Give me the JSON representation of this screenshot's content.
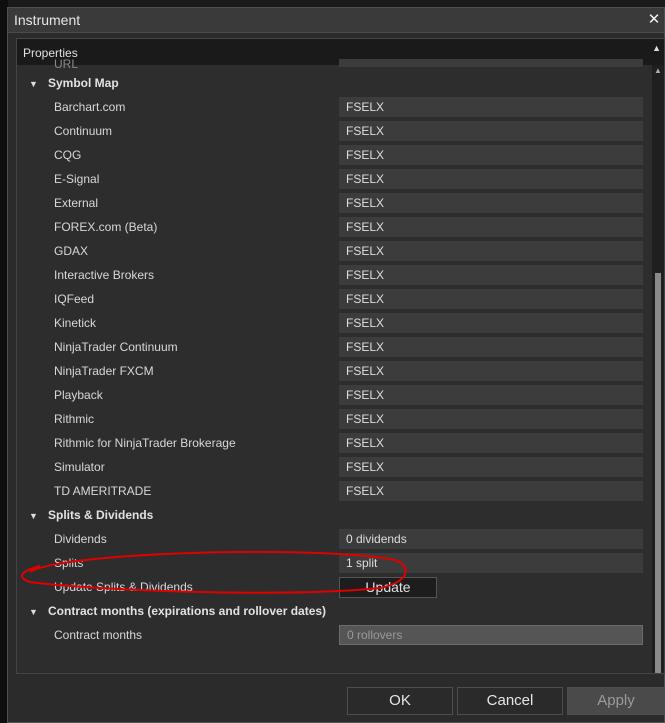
{
  "window": {
    "title": "Instrument"
  },
  "panel": {
    "header": "Properties"
  },
  "partial_row": {
    "label": "URL"
  },
  "categories": [
    {
      "label": "Symbol Map"
    },
    {
      "label": "Splits & Dividends"
    },
    {
      "label": "Contract months (expirations and rollover dates)"
    }
  ],
  "symbol_map": [
    {
      "label": "Barchart.com",
      "value": "FSELX"
    },
    {
      "label": "Continuum",
      "value": "FSELX"
    },
    {
      "label": "CQG",
      "value": "FSELX"
    },
    {
      "label": "E-Signal",
      "value": "FSELX"
    },
    {
      "label": "External",
      "value": "FSELX"
    },
    {
      "label": "FOREX.com (Beta)",
      "value": "FSELX"
    },
    {
      "label": "GDAX",
      "value": "FSELX"
    },
    {
      "label": "Interactive Brokers",
      "value": "FSELX"
    },
    {
      "label": "IQFeed",
      "value": "FSELX"
    },
    {
      "label": "Kinetick",
      "value": "FSELX"
    },
    {
      "label": "NinjaTrader Continuum",
      "value": "FSELX"
    },
    {
      "label": "NinjaTrader FXCM",
      "value": "FSELX"
    },
    {
      "label": "Playback",
      "value": "FSELX"
    },
    {
      "label": "Rithmic",
      "value": "FSELX"
    },
    {
      "label": "Rithmic for NinjaTrader Brokerage",
      "value": "FSELX"
    },
    {
      "label": "Simulator",
      "value": "FSELX"
    },
    {
      "label": "TD AMERITRADE",
      "value": "FSELX"
    }
  ],
  "splits_dividends": {
    "dividends": {
      "label": "Dividends",
      "value": "0 dividends"
    },
    "splits": {
      "label": "Splits",
      "value": "1 split"
    },
    "update": {
      "label": "Update Splits & Dividends",
      "button": "Update"
    }
  },
  "contract_months": {
    "label": "Contract months",
    "value": "0 rollovers"
  },
  "footer": {
    "ok": "OK",
    "cancel": "Cancel",
    "apply": "Apply"
  },
  "colors": {
    "annotation": "#e00000"
  }
}
